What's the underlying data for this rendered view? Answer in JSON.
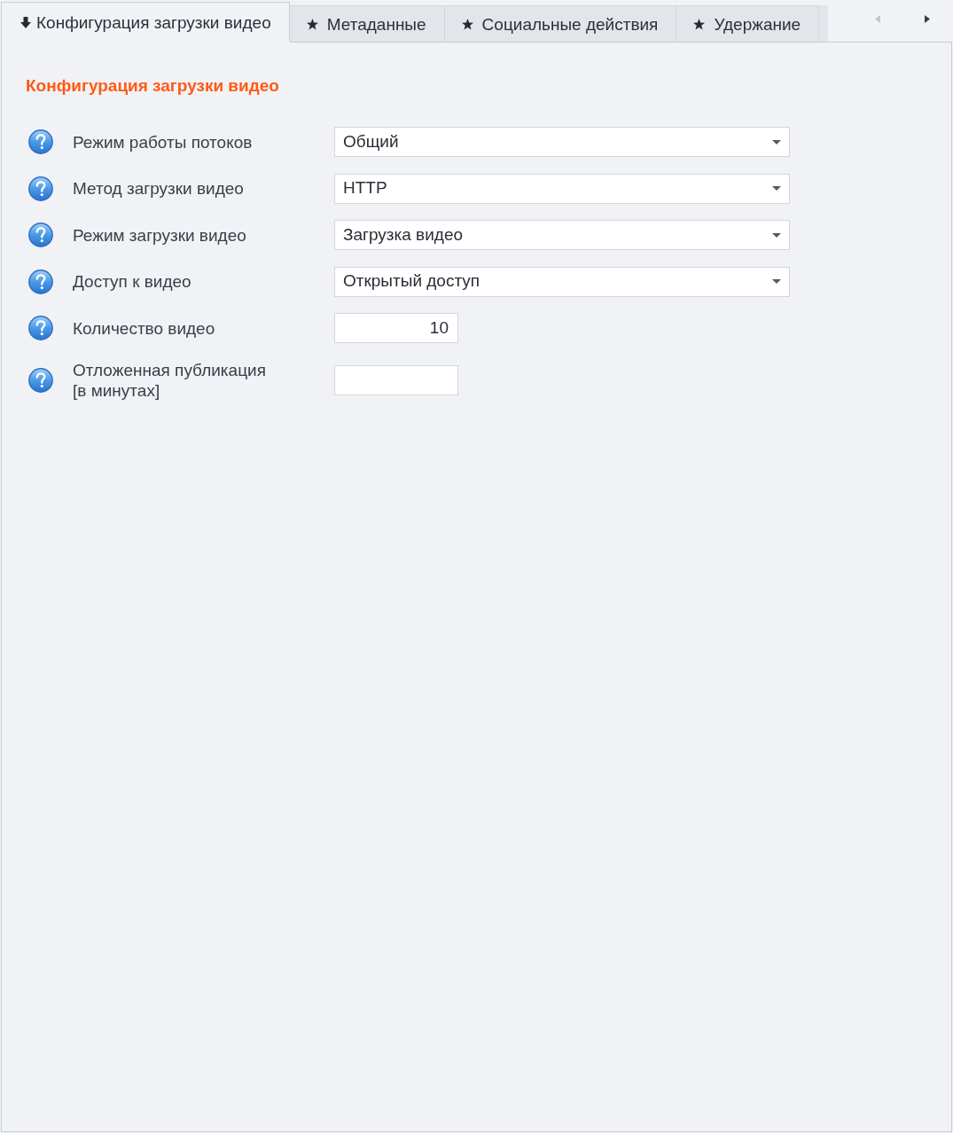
{
  "tabs": [
    {
      "label": "Конфигурация загрузки видео",
      "kind": "download",
      "selected": true
    },
    {
      "label": "Метаданные",
      "kind": "starred",
      "selected": false
    },
    {
      "label": "Социальные действия",
      "kind": "starred",
      "selected": false
    },
    {
      "label": "Удержание",
      "kind": "starred",
      "selected": false
    }
  ],
  "tab_scroll_buttons": [
    {
      "kind": "left",
      "disabled": true
    },
    {
      "kind": "right",
      "disabled": false
    }
  ],
  "panel": {
    "title": "Конфигурация загрузки видео",
    "rows": [
      {
        "label": "Режим работы потоков",
        "field": {
          "kind": "dropdown",
          "value": "Общий"
        }
      },
      {
        "label": "Метод загрузки видео",
        "field": {
          "kind": "dropdown",
          "value": "HTTP"
        }
      },
      {
        "label": "Режим загрузки видео",
        "field": {
          "kind": "dropdown",
          "value": "Загрузка видео"
        }
      },
      {
        "label": "Доступ к видео",
        "field": {
          "kind": "dropdown",
          "value": "Открытый доступ"
        }
      },
      {
        "label": "Количество видео",
        "field": {
          "kind": "number",
          "value": "10"
        }
      },
      {
        "label": "Отложенная публикация\n[в минутах]",
        "field": {
          "kind": "number"
        }
      }
    ]
  }
}
